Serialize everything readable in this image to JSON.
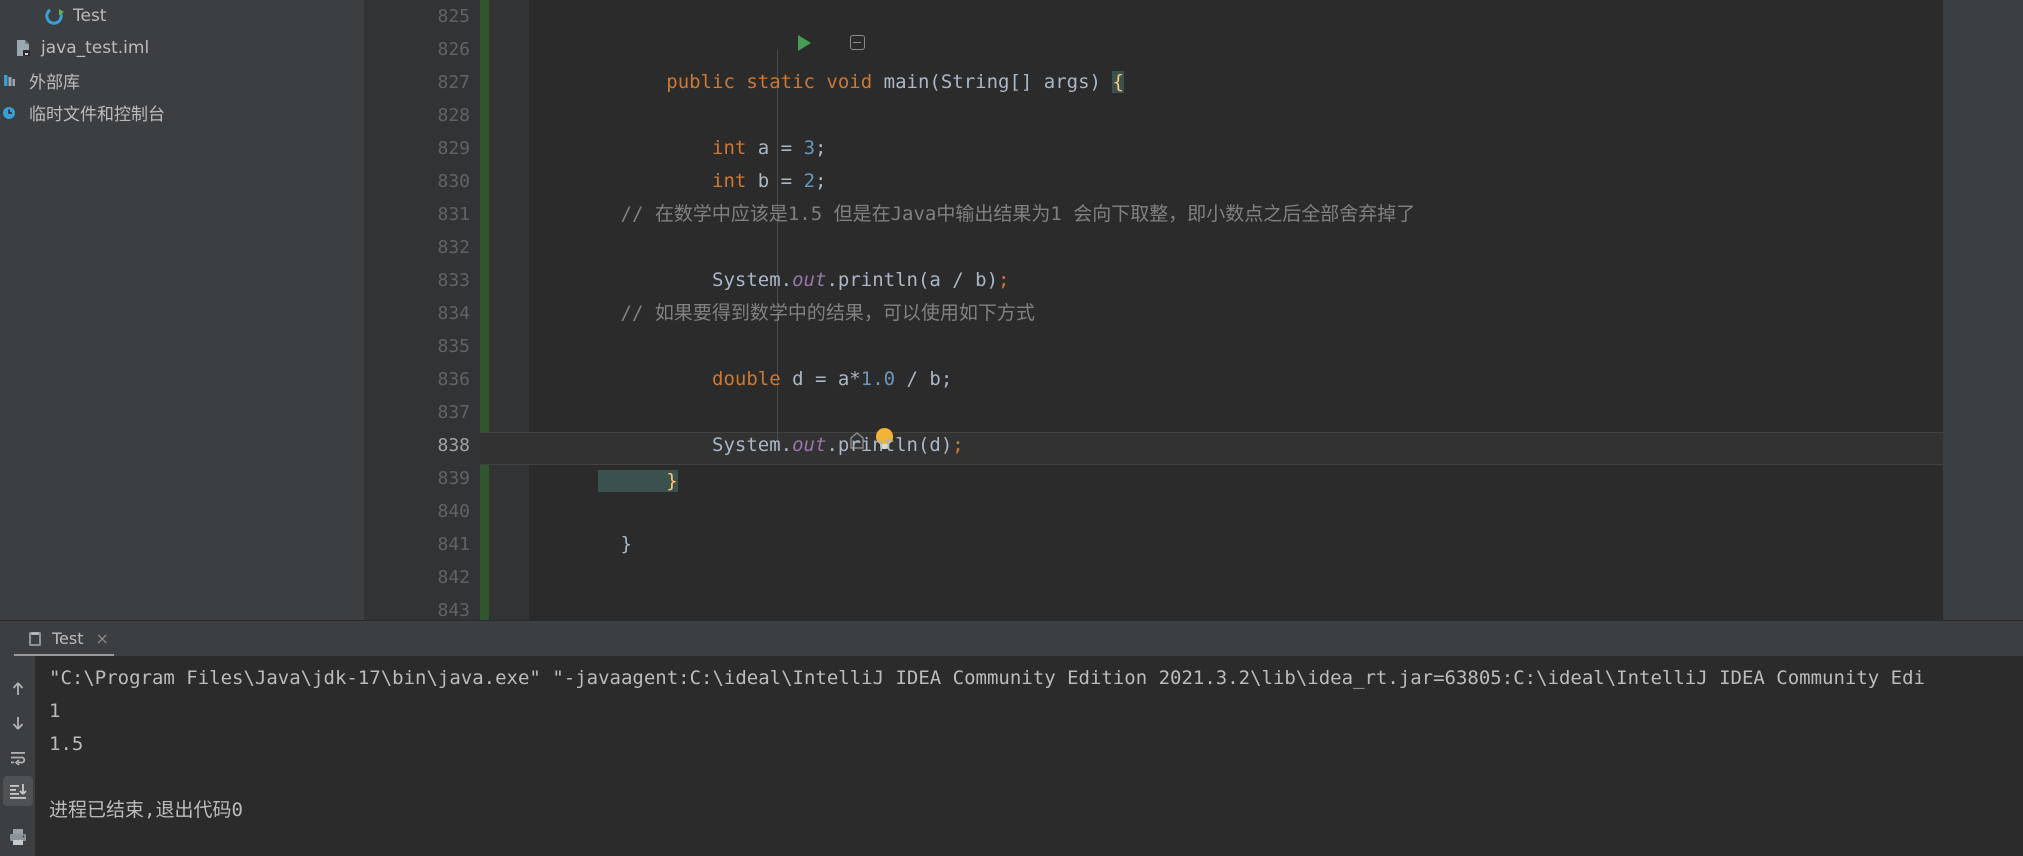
{
  "sidebar": {
    "items": [
      {
        "label": "Test",
        "icon": "java-class-icon",
        "indent": 2
      },
      {
        "label": "java_test.iml",
        "icon": "module-file-icon",
        "indent": 1
      },
      {
        "label": "外部库",
        "icon": "external-libraries-icon",
        "indent": 0
      },
      {
        "label": "临时文件和控制台",
        "icon": "scratches-consoles-icon",
        "indent": 0
      }
    ]
  },
  "editor": {
    "first_line_number": 825,
    "current_line_number": 838,
    "lines": [
      {
        "num": 825,
        "text": ""
      },
      {
        "num": 826,
        "text": "    public static void main(String[] args) {"
      },
      {
        "num": 827,
        "text": ""
      },
      {
        "num": 828,
        "text": "        int a = 3;"
      },
      {
        "num": 829,
        "text": "        int b = 2;"
      },
      {
        "num": 830,
        "text": ""
      },
      {
        "num": 831,
        "text": "        // 在数学中应该是1.5 但是在Java中输出结果为1 会向下取整，即小数点之后全部舍弃掉了"
      },
      {
        "num": 832,
        "text": "        System.out.println(a / b);"
      },
      {
        "num": 833,
        "text": ""
      },
      {
        "num": 834,
        "text": "        // 如果要得到数学中的结果，可以使用如下方式"
      },
      {
        "num": 835,
        "text": "        double d = a*1.0 / b;"
      },
      {
        "num": 836,
        "text": ""
      },
      {
        "num": 837,
        "text": "        System.out.println(d);"
      },
      {
        "num": 838,
        "text": "    }"
      },
      {
        "num": 839,
        "text": ""
      },
      {
        "num": 840,
        "text": "}"
      },
      {
        "num": 841,
        "text": ""
      },
      {
        "num": 842,
        "text": ""
      },
      {
        "num": 843,
        "text": ""
      }
    ],
    "gutter_icons": {
      "run_line": 826,
      "fold_open_line": 826,
      "fold_close_line": 838,
      "intention_bulb_line": 838
    }
  },
  "run_panel": {
    "tab": {
      "label": "Test",
      "icon": "console-icon",
      "close": "×"
    },
    "toolbar": [
      {
        "name": "scroll-up-icon",
        "active": false
      },
      {
        "name": "scroll-down-icon",
        "active": false
      },
      {
        "name": "soft-wrap-icon",
        "active": false
      },
      {
        "name": "scroll-to-end-icon",
        "active": true
      },
      {
        "name": "print-icon",
        "active": false
      }
    ],
    "console_lines": [
      "\"C:\\Program Files\\Java\\jdk-17\\bin\\java.exe\" \"-javaagent:C:\\ideal\\IntelliJ IDEA Community Edition 2021.3.2\\lib\\idea_rt.jar=63805:C:\\ideal\\IntelliJ IDEA Community Edi",
      "1",
      "1.5",
      "",
      "进程已结束,退出代码0"
    ]
  },
  "colors": {
    "editor_bg": "#2b2b2b",
    "panel_bg": "#3c3f41",
    "gutter_bg": "#313335",
    "keyword": "#cc7832",
    "number": "#6897bb",
    "comment": "#808080",
    "identifier": "#a9b7c6",
    "field": "#9876aa",
    "vcs_stripe": "#31562f",
    "run_green": "#499c54",
    "bulb_yellow": "#f5b335"
  }
}
